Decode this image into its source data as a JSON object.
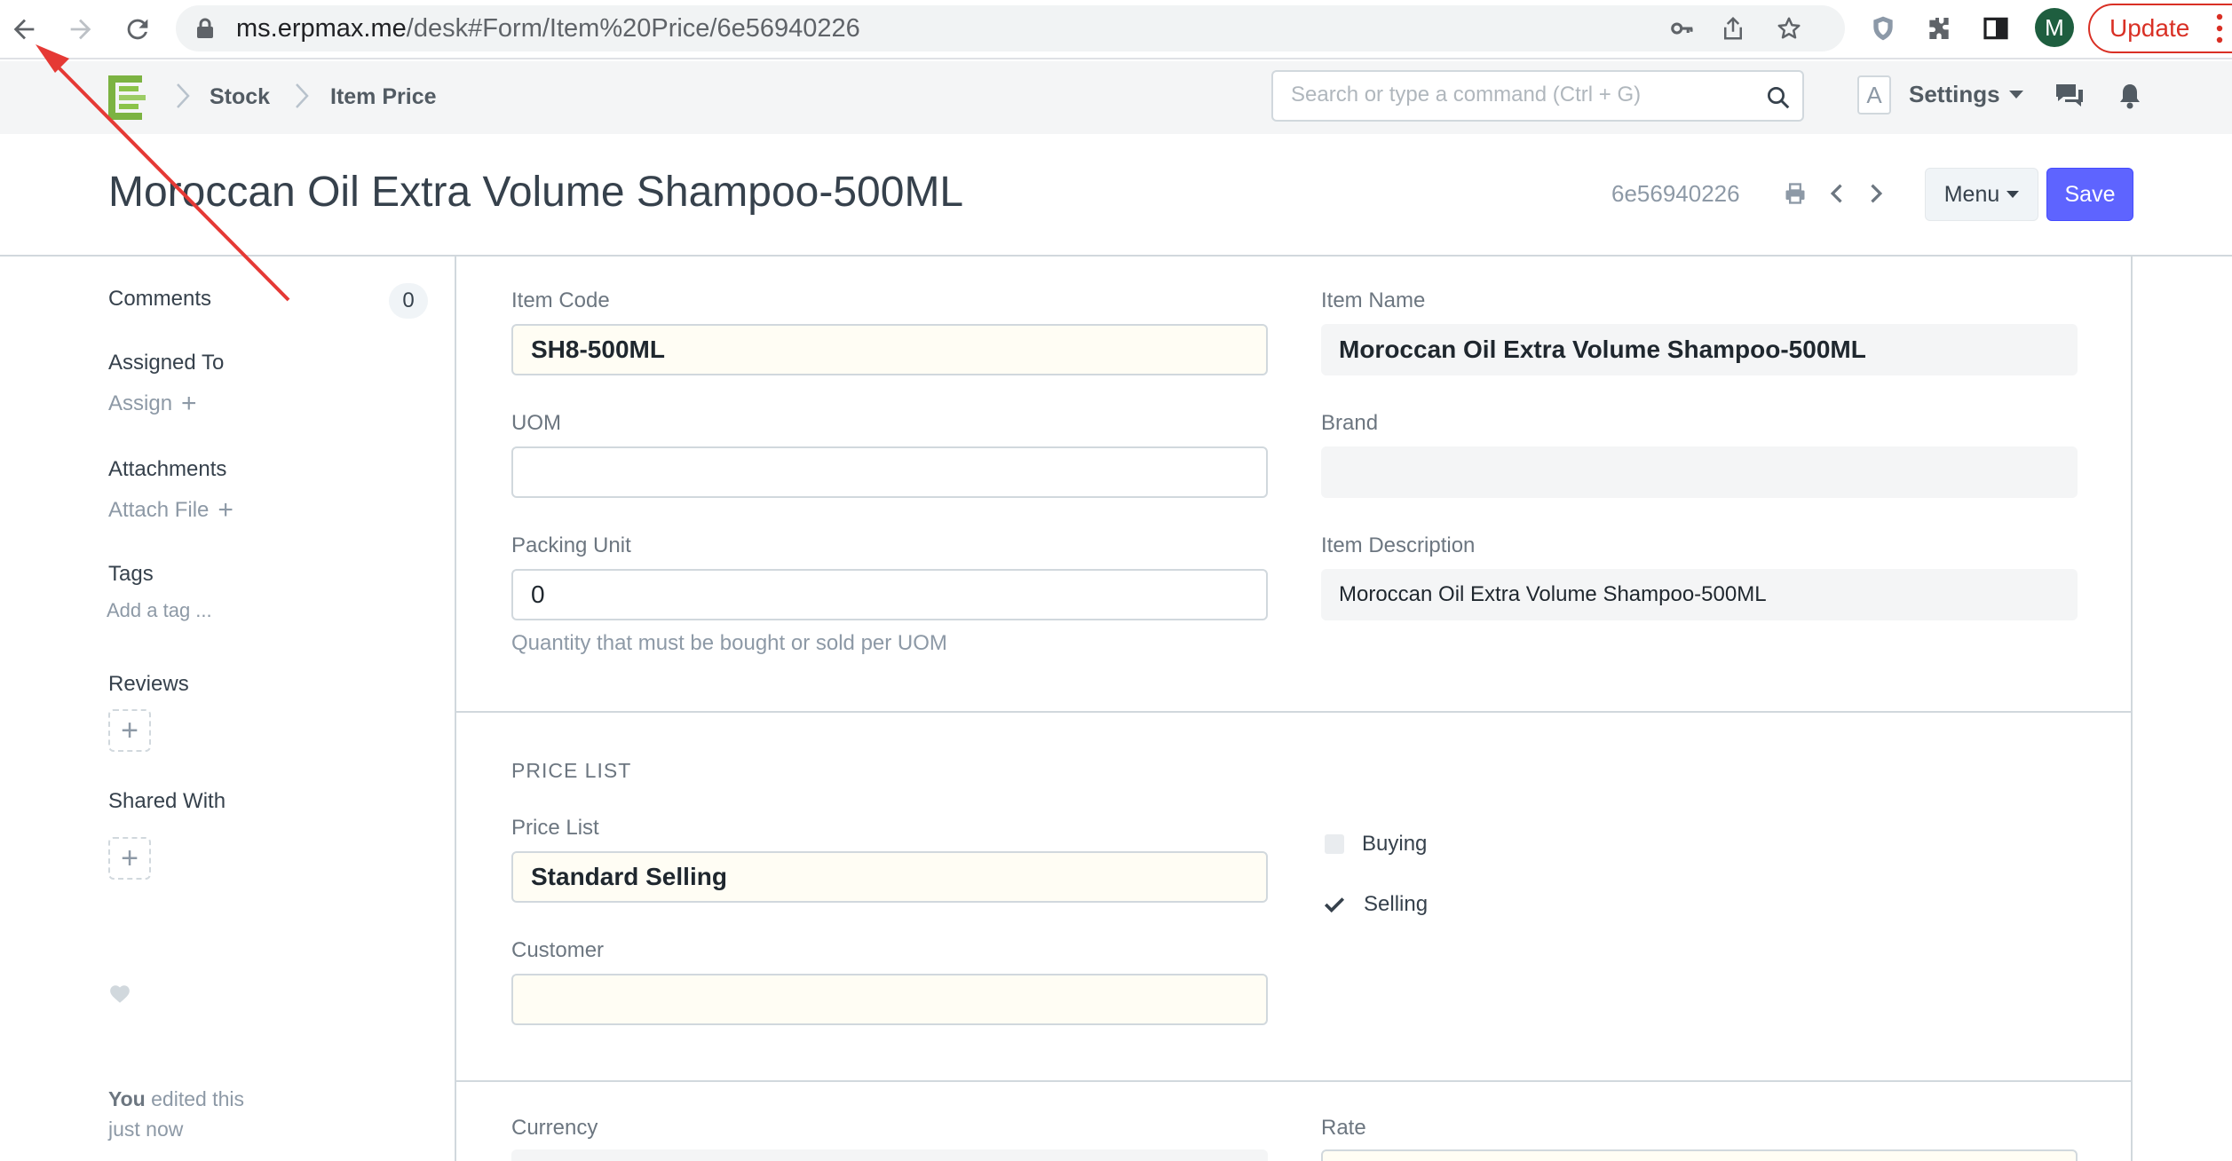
{
  "browser": {
    "url_host": "ms.erpmax.me",
    "url_path": "/desk#Form/Item%20Price/6e56940226",
    "profile_initial": "M",
    "update_label": "Update"
  },
  "navbar": {
    "breadcrumbs": [
      "Stock",
      "Item Price"
    ],
    "search_placeholder": "Search or type a command (Ctrl + G)",
    "avatar_letter": "A",
    "settings_label": "Settings"
  },
  "header": {
    "title": "Moroccan Oil Extra Volume Shampoo-500ML",
    "doc_id": "6e56940226",
    "menu_label": "Menu",
    "save_label": "Save"
  },
  "sidebar": {
    "comments_label": "Comments",
    "comments_count": "0",
    "assigned_to_label": "Assigned To",
    "assign_label": "Assign",
    "attachments_label": "Attachments",
    "attach_file_label": "Attach File",
    "tags_label": "Tags",
    "add_tag_label": "Add a tag ...",
    "reviews_label": "Reviews",
    "shared_with_label": "Shared With",
    "edited_by": "You",
    "edited_text": "edited this",
    "edited_when": "just now"
  },
  "form": {
    "item_code": {
      "label": "Item Code",
      "value": "SH8-500ML"
    },
    "item_name": {
      "label": "Item Name",
      "value": "Moroccan Oil Extra Volume Shampoo-500ML"
    },
    "uom": {
      "label": "UOM",
      "value": ""
    },
    "brand": {
      "label": "Brand",
      "value": ""
    },
    "packing_unit": {
      "label": "Packing Unit",
      "value": "0",
      "help": "Quantity that must be bought or sold per UOM"
    },
    "item_description": {
      "label": "Item Description",
      "value": "Moroccan Oil Extra Volume Shampoo-500ML"
    },
    "price_list_section": "PRICE LIST",
    "price_list": {
      "label": "Price List",
      "value": "Standard Selling"
    },
    "customer": {
      "label": "Customer",
      "value": ""
    },
    "buying": {
      "label": "Buying",
      "checked": false
    },
    "selling": {
      "label": "Selling",
      "checked": true
    },
    "currency": {
      "label": "Currency"
    },
    "rate": {
      "label": "Rate"
    }
  },
  "colors": {
    "primary": "#5e64ff",
    "annotation_arrow": "#e53935",
    "update_red": "#d93025"
  }
}
